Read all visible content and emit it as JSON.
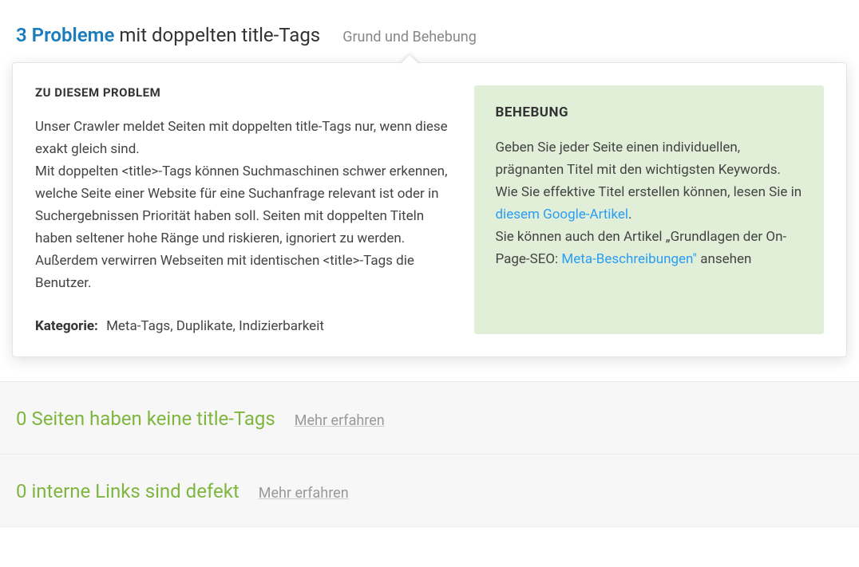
{
  "header": {
    "count": "3",
    "problem_label": "Probleme",
    "rest": "mit doppelten title-Tags",
    "tooltip_trigger": "Grund und Behebung"
  },
  "about": {
    "heading": "ZU DIESEM PROBLEM",
    "para1": "Unser Crawler meldet Seiten mit doppelten title-Tags nur, wenn diese exakt gleich sind.",
    "para2": "Mit doppelten <title>-Tags können Suchmaschinen schwer erkennen, welche Seite einer Website für eine Suchanfrage relevant ist oder in Suchergebnissen Priorität haben soll. Seiten mit doppelten Titeln haben seltener hohe Ränge und riskieren, ignoriert zu werden.",
    "para3": "Außerdem verwirren Webseiten mit identischen <title>-Tags die Benutzer.",
    "category_label": "Kategorie:",
    "category_value": "Meta-Tags, Duplikate, Indizierbarkeit"
  },
  "fix": {
    "heading": "BEHEBUNG",
    "intro": "Geben Sie jeder Seite einen individuellen, prägnanten Titel mit den wichtigsten Keywords.",
    "line2_a": "Wie Sie effektive Titel erstellen können, lesen Sie in ",
    "line2_link": "diesem Google-Artikel",
    "line2_b": ".",
    "line3_a": "Sie können auch den Artikel „Grundlagen der On-Page-SEO: ",
    "line3_link": "Meta-Beschreibungen\"",
    "line3_b": " ansehen"
  },
  "rows": {
    "row1": {
      "title": "0 Seiten haben keine title-Tags",
      "more": "Mehr erfahren"
    },
    "row2": {
      "title": "0 interne Links sind defekt",
      "more": "Mehr erfahren"
    }
  }
}
